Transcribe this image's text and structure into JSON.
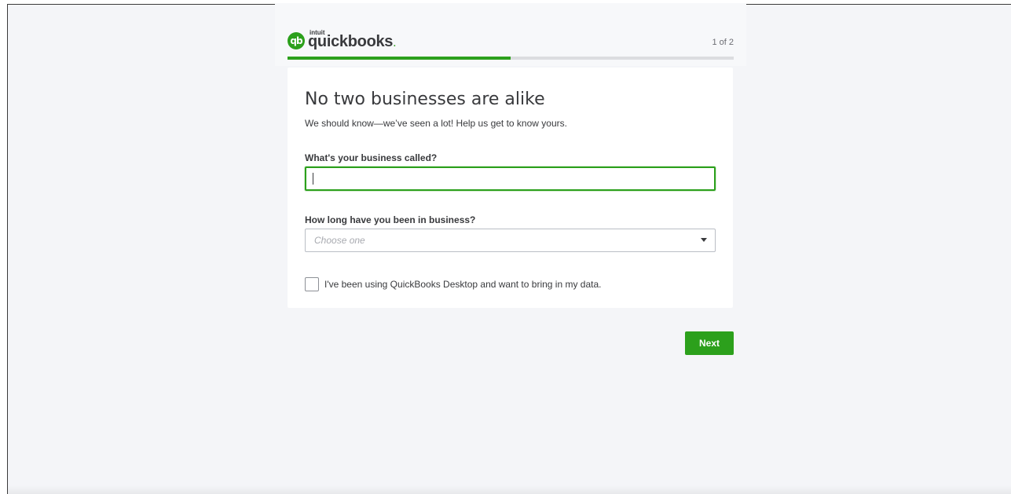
{
  "brand": {
    "intuit_label": "intuit",
    "wordmark": "quickbooks",
    "mark": "qb",
    "accent_color": "#2ca01c"
  },
  "progress": {
    "step_text": "1 of 2",
    "fraction": 0.5
  },
  "form": {
    "heading": "No two businesses are alike",
    "subheading": "We should know—we’ve seen a lot! Help us get to know yours.",
    "business_name": {
      "label": "What's your business called?",
      "value": ""
    },
    "business_age": {
      "label": "How long have you been in business?",
      "placeholder": "Choose one",
      "icon": "caret-down-icon"
    },
    "desktop_import": {
      "label": "I've been using QuickBooks Desktop and want to bring in my data.",
      "checked": false
    }
  },
  "actions": {
    "next_label": "Next"
  }
}
